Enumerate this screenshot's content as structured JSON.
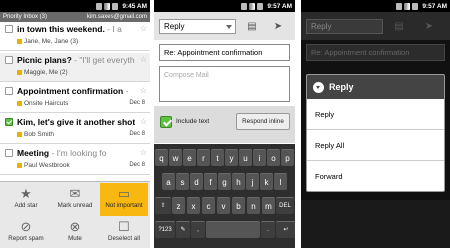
{
  "status": {
    "time_1": "9:45 AM",
    "time_2": "9:57 AM",
    "time_3": "9:57 AM"
  },
  "inbox": {
    "title": "Priority Inbox (3)",
    "account": "kim.saxes@gmail.com",
    "messages": [
      {
        "subject": "in town this weekend.",
        "snippet": " - I a",
        "from": "Jane, Me, Jane (3)",
        "date": "",
        "tag_color": "#e9b200",
        "unread": true,
        "checked": false
      },
      {
        "subject": "Picnic plans?",
        "snippet": " - \"I'll get everythi",
        "from": "Maggie, Me (2)",
        "date": "",
        "tag_color": "#e9b200",
        "unread": false,
        "checked": false
      },
      {
        "subject": "Appointment confirmation",
        "snippet": " -",
        "from": "Onsite Haircuts",
        "date": "Dec 8",
        "tag_color": "#e9b200",
        "unread": true,
        "checked": false
      },
      {
        "subject": "Kim, let's give it another shot!",
        "snippet": "",
        "from": "Bob Smith",
        "date": "Dec 8",
        "tag_color": "#e9b200",
        "unread": false,
        "checked": true
      },
      {
        "subject": "Meeting",
        "snippet": " - I'm looking fo",
        "from": "Paul Westbrook",
        "date": "Dec 8",
        "tag_color": "#e9b200",
        "unread": true,
        "checked": false
      }
    ],
    "actions": [
      {
        "label": "Add star",
        "icon": "★"
      },
      {
        "label": "Mark unread",
        "icon": "✉"
      },
      {
        "label": "Not important",
        "icon": "▭"
      },
      {
        "label": "Report spam",
        "icon": "⊘"
      },
      {
        "label": "Mute",
        "icon": "⊗"
      },
      {
        "label": "Deselect all",
        "icon": "☐"
      }
    ]
  },
  "compose": {
    "mode": "Reply",
    "subject": "Re: Appointment confirmation",
    "body_placeholder": "Compose Mail",
    "include_text_label": "Include text",
    "respond_inline_label": "Respond inline"
  },
  "keyboard": {
    "row1": [
      "q",
      "w",
      "e",
      "r",
      "t",
      "y",
      "u",
      "i",
      "o",
      "p"
    ],
    "row2": [
      "a",
      "s",
      "d",
      "f",
      "g",
      "h",
      "j",
      "k",
      "l"
    ],
    "row3": [
      "⇧",
      "z",
      "x",
      "c",
      "v",
      "b",
      "n",
      "m",
      "DEL"
    ],
    "row4": [
      "?123",
      "✎",
      ",",
      "",
      ".",
      " ↵"
    ]
  },
  "reply_menu": {
    "title": "Reply",
    "items": [
      "Reply",
      "Reply All",
      "Forward"
    ]
  },
  "dim_background": {
    "mode": "Reply",
    "subject": "Re: Appointment confirmation"
  }
}
